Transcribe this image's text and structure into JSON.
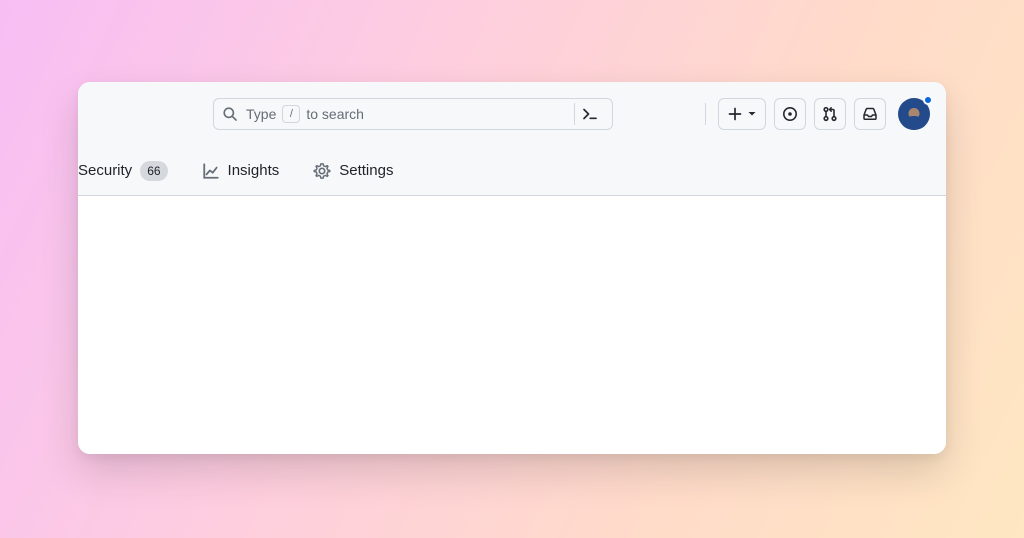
{
  "search": {
    "placeholder_pre": "Type",
    "placeholder_key": "/",
    "placeholder_post": "to search"
  },
  "topbar": {
    "create_label": "Create new",
    "issues_label": "Issues",
    "pulls_label": "Pull requests",
    "inbox_label": "Notifications",
    "command_label": "Command palette"
  },
  "tabs": {
    "security": {
      "label": "Security",
      "count": "66"
    },
    "insights": {
      "label": "Insights"
    },
    "settings": {
      "label": "Settings"
    }
  },
  "user": {
    "has_unread": true,
    "notification_color": "#0969da"
  }
}
